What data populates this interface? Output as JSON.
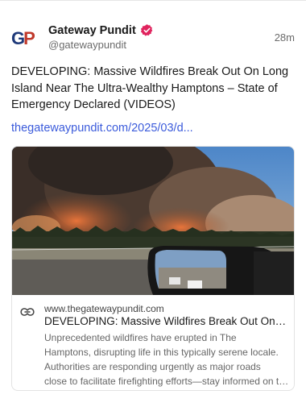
{
  "post": {
    "author": {
      "logo_letters": [
        "G",
        "P"
      ],
      "display_name": "Gateway Pundit",
      "handle": "@gatewaypundit",
      "verified": true
    },
    "timestamp": "28m",
    "text": "DEVELOPING: Massive Wildfires Break Out On Long Island Near The Ultra-Wealthy Hamptons – State of Emergency Declared (VIDEOS)",
    "link_text": "thegatewaypundit.com/2025/03/d..."
  },
  "preview": {
    "icon": "link-icon",
    "domain": "www.thegatewaypundit.com",
    "title": "DEVELOPING: Massive Wildfires Break Out On Long Island Near The Ultra-Wealthy Hamptons",
    "description_lines": [
      "Unprecedented wildfires have erupted in The",
      "Hamptons, disrupting life in this typically serene locale.",
      "Authorities are responding urgently as major roads",
      "close to facilitate firefighting efforts—stay informed on the latest developments."
    ]
  },
  "colors": {
    "link": "#3b5bdb",
    "verified_badge": "#e0245e",
    "logo_blue": "#1f3a7a",
    "logo_red": "#c0392b"
  }
}
